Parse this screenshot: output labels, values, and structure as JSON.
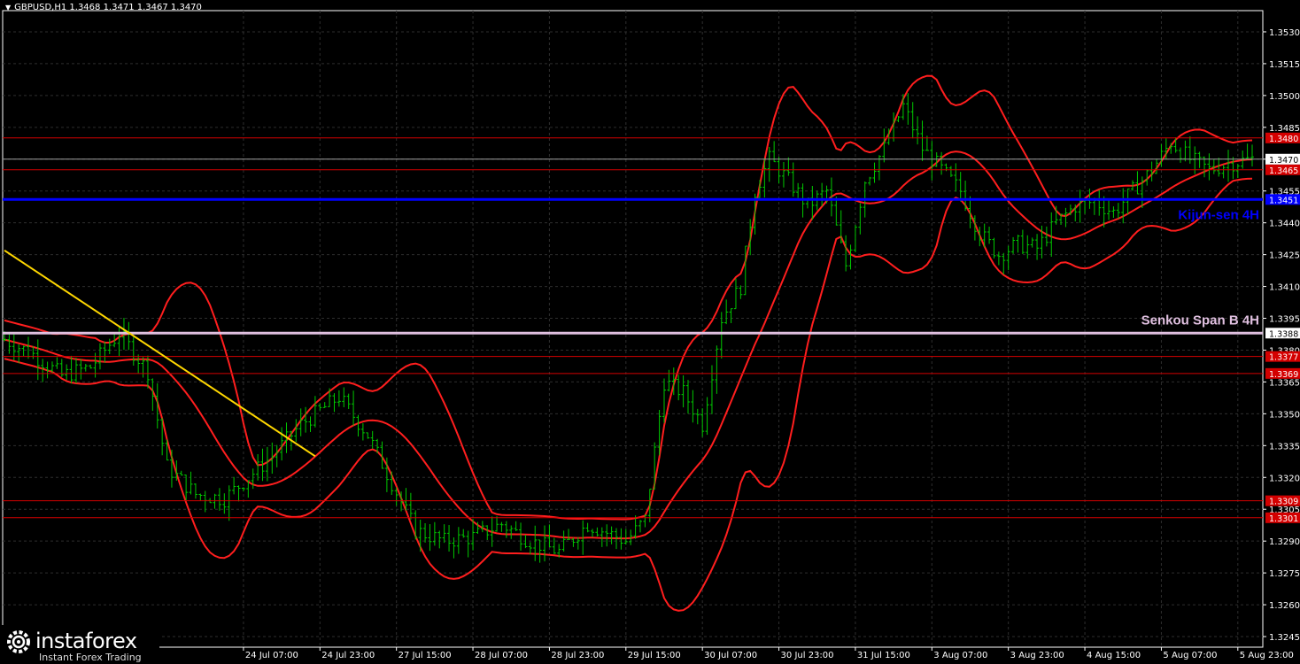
{
  "header": {
    "symbol_line": "GBPUSD,H1  1.3468 1.3471 1.3467 1.3470"
  },
  "logo": {
    "name": "instaforex",
    "tagline": "Instant Forex Trading",
    "icon": "gear-logo-icon"
  },
  "colors": {
    "background": "#000000",
    "grid": "#2e2e2e",
    "axis": "#ffffff",
    "candle": "#00c800",
    "bands": "#ff1e1e",
    "level": "#d40000",
    "kijun": "#0000ff",
    "senkou": "#e0c0e0",
    "trend": "#ffd700",
    "label_bg": "#d40000"
  },
  "chart_data": {
    "type": "candlestick",
    "symbol": "GBPUSD",
    "timeframe": "H1",
    "ohlc_last": {
      "open": 1.3468,
      "high": 1.3471,
      "low": 1.3467,
      "close": 1.347
    },
    "ylim": [
      1.324,
      1.354
    ],
    "y_ticks": [
      1.353,
      1.3515,
      1.35,
      1.3485,
      1.347,
      1.3455,
      1.344,
      1.3425,
      1.341,
      1.3395,
      1.338,
      1.3365,
      1.335,
      1.3335,
      1.332,
      1.3305,
      1.329,
      1.3275,
      1.326,
      1.3245
    ],
    "x_labels": [
      {
        "bar": 50,
        "label": "24 Jul 07:00"
      },
      {
        "bar": 66,
        "label": "24 Jul 23:00"
      },
      {
        "bar": 82,
        "label": "27 Jul 15:00"
      },
      {
        "bar": 98,
        "label": "28 Jul 07:00"
      },
      {
        "bar": 114,
        "label": "28 Jul 23:00"
      },
      {
        "bar": 130,
        "label": "29 Jul 15:00"
      },
      {
        "bar": 146,
        "label": "30 Jul 07:00"
      },
      {
        "bar": 162,
        "label": "30 Jul 23:00"
      },
      {
        "bar": 178,
        "label": "31 Jul 15:00"
      },
      {
        "bar": 194,
        "label": "3 Aug 07:00"
      },
      {
        "bar": 210,
        "label": "3 Aug 23:00"
      },
      {
        "bar": 226,
        "label": "4 Aug 15:00"
      },
      {
        "bar": 242,
        "label": "5 Aug 07:00"
      },
      {
        "bar": 258,
        "label": "5 Aug 23:00"
      }
    ],
    "bar_count": 262,
    "close_path": [
      [
        0,
        1.3385
      ],
      [
        6,
        1.3378
      ],
      [
        12,
        1.3368
      ],
      [
        18,
        1.3372
      ],
      [
        24,
        1.3388
      ],
      [
        30,
        1.337
      ],
      [
        34,
        1.3325
      ],
      [
        40,
        1.3312
      ],
      [
        46,
        1.331
      ],
      [
        50,
        1.3318
      ],
      [
        56,
        1.333
      ],
      [
        62,
        1.3345
      ],
      [
        70,
        1.3358
      ],
      [
        76,
        1.334
      ],
      [
        80,
        1.3322
      ],
      [
        86,
        1.3295
      ],
      [
        92,
        1.329
      ],
      [
        98,
        1.3292
      ],
      [
        104,
        1.3298
      ],
      [
        110,
        1.329
      ],
      [
        116,
        1.3285
      ],
      [
        122,
        1.3298
      ],
      [
        130,
        1.329
      ],
      [
        134,
        1.33
      ],
      [
        138,
        1.3365
      ],
      [
        142,
        1.336
      ],
      [
        146,
        1.3345
      ],
      [
        150,
        1.3395
      ],
      [
        154,
        1.341
      ],
      [
        157,
        1.3455
      ],
      [
        160,
        1.347
      ],
      [
        164,
        1.346
      ],
      [
        168,
        1.3448
      ],
      [
        172,
        1.3455
      ],
      [
        176,
        1.342
      ],
      [
        180,
        1.346
      ],
      [
        184,
        1.3475
      ],
      [
        188,
        1.3495
      ],
      [
        192,
        1.3475
      ],
      [
        196,
        1.3465
      ],
      [
        200,
        1.3455
      ],
      [
        204,
        1.3435
      ],
      [
        208,
        1.3425
      ],
      [
        212,
        1.343
      ],
      [
        216,
        1.3428
      ],
      [
        220,
        1.344
      ],
      [
        224,
        1.3448
      ],
      [
        228,
        1.345
      ],
      [
        232,
        1.3445
      ],
      [
        236,
        1.3455
      ],
      [
        240,
        1.3465
      ],
      [
        244,
        1.3478
      ],
      [
        248,
        1.347
      ],
      [
        252,
        1.3465
      ],
      [
        256,
        1.3468
      ],
      [
        261,
        1.347
      ]
    ],
    "levels": [
      {
        "price": 1.348,
        "label": "1.3480"
      },
      {
        "price": 1.3465,
        "label": "1.3465"
      },
      {
        "price": 1.3377,
        "label": "1.3377"
      },
      {
        "price": 1.3369,
        "label": "1.3369"
      },
      {
        "price": 1.3309,
        "label": "1.3309"
      },
      {
        "price": 1.3301,
        "label": "1.3301"
      }
    ],
    "kijun_sen": {
      "price": 1.3451,
      "label": "1.3451",
      "name": "Kijun-sen 4H"
    },
    "senkou_span_b": {
      "price": 1.3388,
      "label": "1.3388",
      "name": "Senkou Span B 4H"
    },
    "current_price": {
      "price": 1.347,
      "label": "1.3470"
    },
    "trend_line": {
      "from": [
        0,
        1.3427
      ],
      "to": [
        65,
        1.333
      ]
    },
    "legend": "none",
    "grid": true
  }
}
